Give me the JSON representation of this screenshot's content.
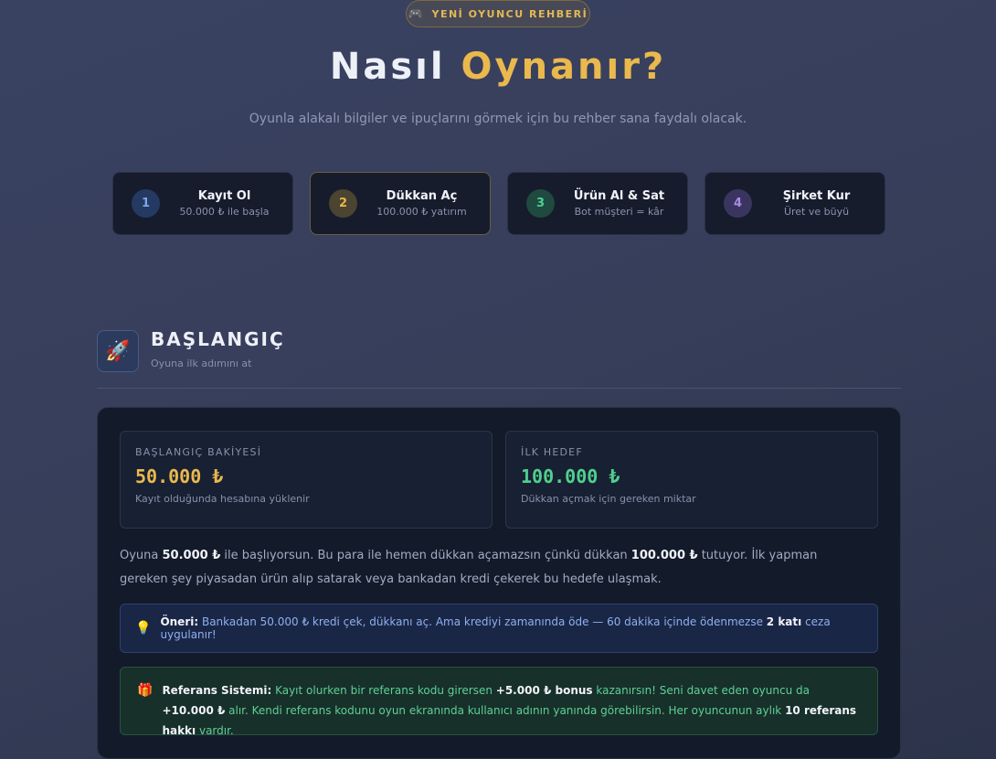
{
  "badge": {
    "label": "YENİ OYUNCU REHBERİ",
    "icon": "gamepad-icon"
  },
  "hero": {
    "title_main": "Nasıl",
    "title_accent": "Oynanır?",
    "subtitle": "Oyunla alakalı bilgiler ve ipuçlarını görmek için bu rehber sana faydalı olacak."
  },
  "steps": [
    {
      "num": "1",
      "title": "Kayıt Ol",
      "sub": "50.000 ₺ ile başla",
      "color": "#7fa5ea"
    },
    {
      "num": "2",
      "title": "Dükkan Aç",
      "sub": "100.000 ₺ yatırım",
      "color": "#e6b84b"
    },
    {
      "num": "3",
      "title": "Ürün Al & Sat",
      "sub": "Bot müşteri = kâr",
      "color": "#4fd08f"
    },
    {
      "num": "4",
      "title": "Şirket Kur",
      "sub": "Üret ve büyü",
      "color": "#a98ce8"
    }
  ],
  "section": {
    "icon": "rocket-icon",
    "title": "BAŞLANGIÇ",
    "subtitle": "Oyuna ilk adımını at"
  },
  "stats": [
    {
      "label": "BAŞLANGIÇ BAKİYESİ",
      "value": "50.000 ₺",
      "desc": "Kayıt olduğunda hesabına yüklenir",
      "color": "#eab84d"
    },
    {
      "label": "İLK HEDEF",
      "value": "100.000 ₺",
      "desc": "Dükkan açmak için gereken miktar",
      "color": "#4fd08f"
    }
  ],
  "intro": {
    "p1": "Oyuna ",
    "b1": "50.000 ₺",
    "p2": " ile başlıyorsun. Bu para ile hemen dükkan açamazsın çünkü dükkan ",
    "b2": "100.000 ₺",
    "p3": " tutuyor. İlk yapman gereken şey piyasadan ürün alıp satarak veya bankadan kredi çekerek bu hedefe ulaşmak."
  },
  "tip": {
    "icon": "lightbulb-icon",
    "label": "Öneri:",
    "t1": " Bankadan 50.000 ₺ kredi çek, dükkanı aç. Ama krediyi zamanında öde — 60 dakika içinde ödenmezse ",
    "b1": "2 katı",
    "t2": " ceza uygulanır!"
  },
  "referral": {
    "icon": "gift-icon",
    "label": "Referans Sistemi:",
    "t1": " Kayıt olurken bir referans kodu girersen ",
    "b1": "+5.000 ₺ bonus",
    "t2": " kazanırsın! Seni davet eden oyuncu da ",
    "b2": "+10.000 ₺",
    "t3": " alır. Kendi referans kodunu oyun ekranında kullanıcı adının yanında görebilirsin. Her oyuncunun aylık ",
    "b3": "10 referans hakkı",
    "t4": " vardır."
  },
  "colors": {
    "accent": "#eab84d",
    "green": "#4fd08f",
    "blue": "#7fa5ea",
    "purple": "#a98ce8"
  }
}
